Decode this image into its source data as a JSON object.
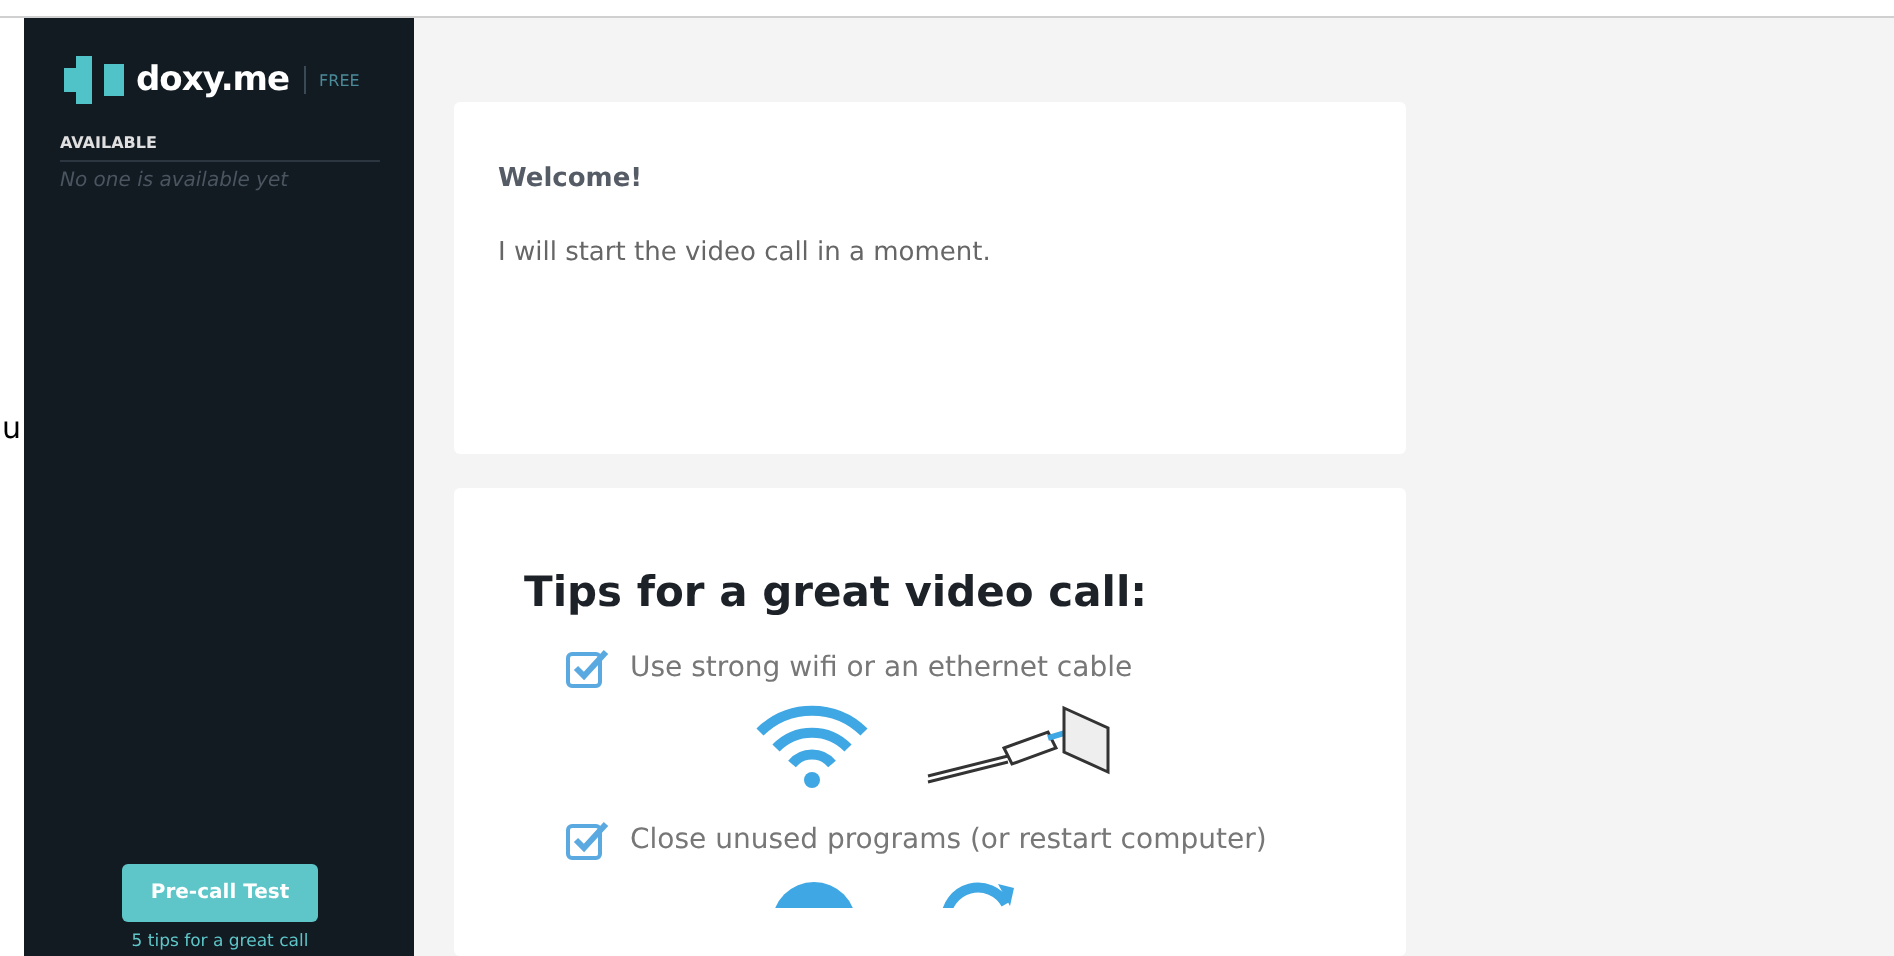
{
  "edge_text": "u",
  "sidebar": {
    "brand": "doxy.me",
    "plan": "FREE",
    "section_title": "AVAILABLE",
    "empty_message": "No one is available yet",
    "button": "Pre-call Test",
    "tips_link": "5 tips for a great call"
  },
  "welcome_card": {
    "title": "Welcome!",
    "message": "I will start the video call in a moment."
  },
  "tips_card": {
    "title": "Tips for a great video call:",
    "tips": [
      {
        "text": "Use strong wifi or an ethernet cable",
        "checked": true,
        "kind": "network"
      },
      {
        "text": "Close unused programs (or restart computer)",
        "checked": true,
        "kind": "programs"
      }
    ]
  }
}
